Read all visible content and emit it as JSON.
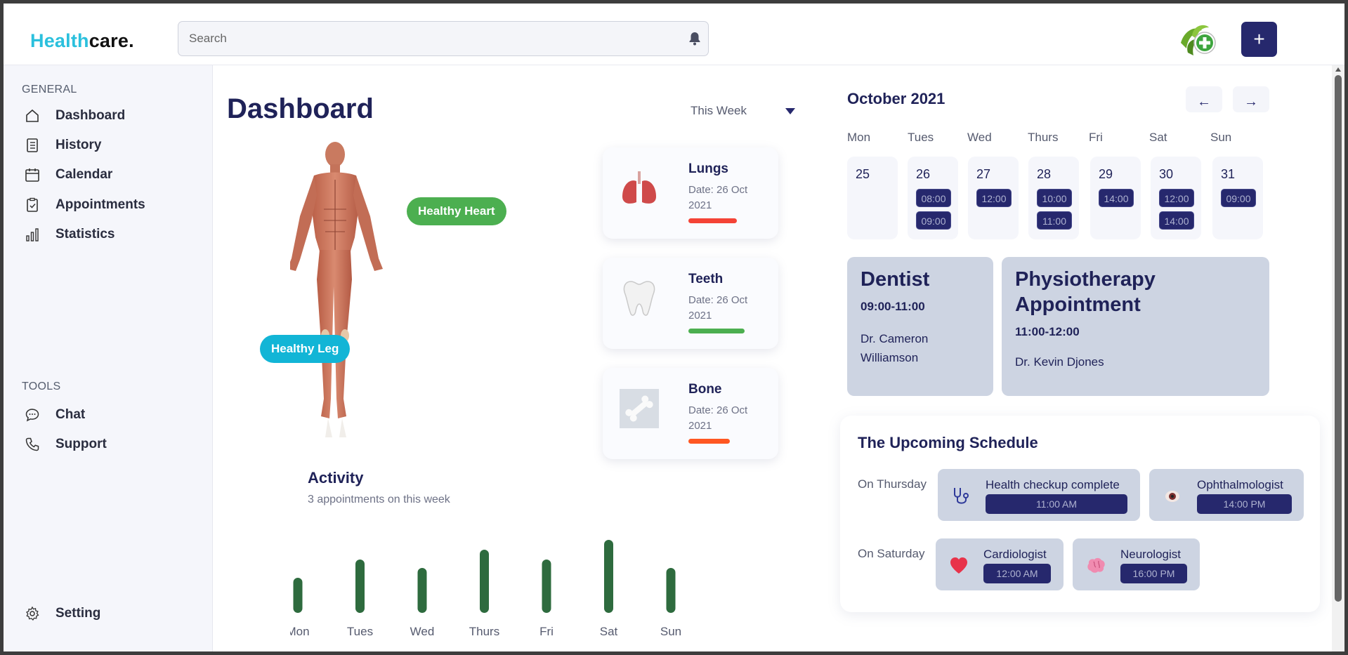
{
  "header": {
    "logo_part1": "Health",
    "logo_part2": "care.",
    "search_placeholder": "Search",
    "add_label": "+"
  },
  "sidebar": {
    "general_label": "GENERAL",
    "items": [
      {
        "label": "Dashboard"
      },
      {
        "label": "History"
      },
      {
        "label": "Calendar"
      },
      {
        "label": "Appointments"
      },
      {
        "label": "Statistics"
      }
    ],
    "tools_label": "TOOLS",
    "tools": [
      {
        "label": "Chat"
      },
      {
        "label": "Support"
      }
    ],
    "setting_label": "Setting"
  },
  "dashboard": {
    "title": "Dashboard",
    "period": "This Week",
    "tags": {
      "heart": "Healthy Heart",
      "leg": "Healthy Leg"
    },
    "cards": [
      {
        "title": "Lungs",
        "date": "Date: 26 Oct 2021",
        "bar_color": "#f44336",
        "bar_fill": 0.46,
        "icon": "lungs-icon"
      },
      {
        "title": "Teeth",
        "date": "Date: 26 Oct 2021",
        "bar_color": "#4caf50",
        "bar_fill": 0.53,
        "icon": "tooth-icon"
      },
      {
        "title": "Bone",
        "date": "Date: 26 Oct 2021",
        "bar_color": "#ff5722",
        "bar_fill": 0.39,
        "icon": "bone-icon"
      }
    ],
    "activity": {
      "title": "Activity",
      "subtitle": "3 appointments on this week"
    }
  },
  "chart_data": {
    "type": "bar",
    "categories": [
      "Mon",
      "Tues",
      "Wed",
      "Thurs",
      "Fri",
      "Sat",
      "Sun"
    ],
    "values": [
      2.5,
      3.8,
      3.2,
      4.5,
      3.8,
      5.2,
      3.2
    ],
    "color": "#2e6b3e"
  },
  "calendar": {
    "month": "October 2021",
    "prev": "←",
    "next": "→",
    "days": [
      {
        "name": "Mon",
        "num": "25",
        "slots": []
      },
      {
        "name": "Tues",
        "num": "26",
        "slots": [
          "08:00",
          "09:00"
        ]
      },
      {
        "name": "Wed",
        "num": "27",
        "slots": [
          "12:00"
        ]
      },
      {
        "name": "Thurs",
        "num": "28",
        "slots": [
          "10:00",
          "11:00"
        ]
      },
      {
        "name": "Fri",
        "num": "29",
        "slots": [
          "14:00"
        ]
      },
      {
        "name": "Sat",
        "num": "30",
        "slots": [
          "12:00",
          "14:00"
        ]
      },
      {
        "name": "Sun",
        "num": "31",
        "slots": [
          "09:00"
        ]
      }
    ]
  },
  "appointments": [
    {
      "title": "Dentist",
      "time": "09:00-11:00",
      "doctor": "Dr. Cameron Williamson"
    },
    {
      "title": "Physiotherapy Appointment",
      "time": "11:00-12:00",
      "doctor": "Dr. Kevin Djones"
    }
  ],
  "upcoming": {
    "title": "The Upcoming Schedule",
    "thursday_label": "On Thursday",
    "saturday_label": "On Saturday",
    "thursday": [
      {
        "name": "Health checkup complete",
        "time": "11:00 AM",
        "icon": "stethoscope-icon"
      },
      {
        "name": "Ophthalmologist",
        "time": "14:00 PM",
        "icon": "eye-icon"
      }
    ],
    "saturday": [
      {
        "name": "Cardiologist",
        "time": "12:00 AM",
        "icon": "heart-icon"
      },
      {
        "name": "Neurologist",
        "time": "16:00 PM",
        "icon": "brain-icon"
      }
    ]
  }
}
